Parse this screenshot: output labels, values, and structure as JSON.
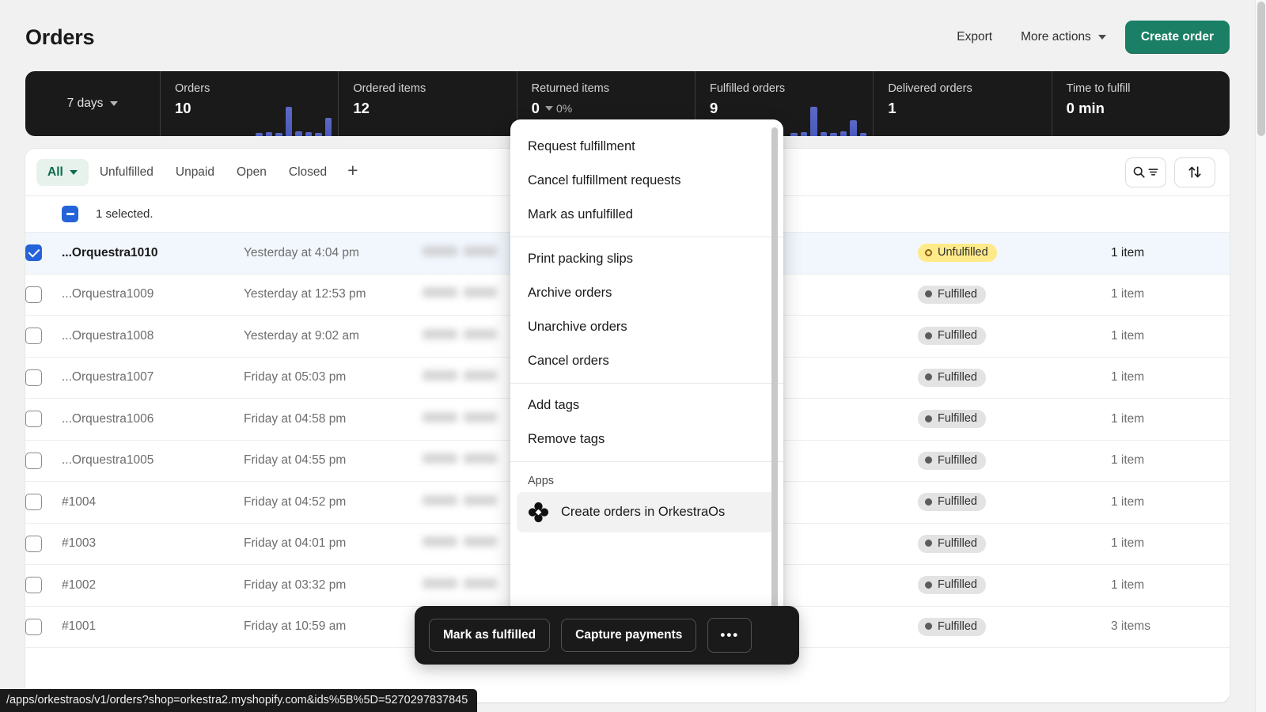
{
  "header": {
    "title": "Orders",
    "export_label": "Export",
    "more_actions_label": "More actions",
    "create_order_label": "Create order"
  },
  "stats": {
    "range_label": "7 days",
    "cells": [
      {
        "label": "Orders",
        "value": "10",
        "delta": "",
        "sparkline": [
          8,
          10,
          9,
          62,
          12,
          11,
          9,
          40
        ]
      },
      {
        "label": "Ordered items",
        "value": "12",
        "delta": "",
        "sparkline": []
      },
      {
        "label": "Returned items",
        "value": "0",
        "delta": "0%",
        "sparkline": []
      },
      {
        "label": "Fulfilled orders",
        "value": "9",
        "delta": "",
        "sparkline": [
          8,
          9,
          62,
          10,
          9,
          12,
          34,
          9
        ]
      },
      {
        "label": "Delivered orders",
        "value": "1",
        "delta": "",
        "sparkline": []
      },
      {
        "label": "Time to fulfill",
        "value": "0 min",
        "delta": "",
        "sparkline": []
      }
    ]
  },
  "tabs": {
    "items": [
      {
        "label": "All",
        "active": true,
        "has_caret": true
      },
      {
        "label": "Unfulfilled",
        "active": false,
        "has_caret": false
      },
      {
        "label": "Unpaid",
        "active": false,
        "has_caret": false
      },
      {
        "label": "Open",
        "active": false,
        "has_caret": false
      },
      {
        "label": "Closed",
        "active": false,
        "has_caret": false
      }
    ],
    "add_label": "+"
  },
  "bulk": {
    "selected_text": "1 selected."
  },
  "table": {
    "rows": [
      {
        "order": "...Orquestra1010",
        "date": "Yesterday at 4:04 pm",
        "status": "Unfulfilled",
        "status_type": "unfulfilled",
        "items": "1 item",
        "selected": true
      },
      {
        "order": "...Orquestra1009",
        "date": "Yesterday at 12:53 pm",
        "status": "Fulfilled",
        "status_type": "fulfilled",
        "items": "1 item",
        "selected": false
      },
      {
        "order": "...Orquestra1008",
        "date": "Yesterday at 9:02 am",
        "status": "Fulfilled",
        "status_type": "fulfilled",
        "items": "1 item",
        "selected": false
      },
      {
        "order": "...Orquestra1007",
        "date": "Friday at 05:03 pm",
        "status": "Fulfilled",
        "status_type": "fulfilled",
        "items": "1 item",
        "selected": false
      },
      {
        "order": "...Orquestra1006",
        "date": "Friday at 04:58 pm",
        "status": "Fulfilled",
        "status_type": "fulfilled",
        "items": "1 item",
        "selected": false
      },
      {
        "order": "...Orquestra1005",
        "date": "Friday at 04:55 pm",
        "status": "Fulfilled",
        "status_type": "fulfilled",
        "items": "1 item",
        "selected": false
      },
      {
        "order": "#1004",
        "date": "Friday at 04:52 pm",
        "status": "Fulfilled",
        "status_type": "fulfilled",
        "items": "1 item",
        "selected": false
      },
      {
        "order": "#1003",
        "date": "Friday at 04:01 pm",
        "status": "Fulfilled",
        "status_type": "fulfilled",
        "items": "1 item",
        "selected": false
      },
      {
        "order": "#1002",
        "date": "Friday at 03:32 pm",
        "status": "Fulfilled",
        "status_type": "fulfilled",
        "items": "1 item",
        "selected": false
      },
      {
        "order": "#1001",
        "date": "Friday at 10:59 am",
        "status": "Fulfilled",
        "status_type": "fulfilled",
        "items": "3 items",
        "selected": false
      }
    ]
  },
  "menu": {
    "groups": [
      {
        "items": [
          {
            "label": "Request fulfillment"
          },
          {
            "label": "Cancel fulfillment requests"
          },
          {
            "label": "Mark as unfulfilled"
          }
        ]
      },
      {
        "items": [
          {
            "label": "Print packing slips"
          },
          {
            "label": "Archive orders"
          },
          {
            "label": "Unarchive orders"
          },
          {
            "label": "Cancel orders"
          }
        ]
      },
      {
        "items": [
          {
            "label": "Add tags"
          },
          {
            "label": "Remove tags"
          }
        ]
      }
    ],
    "apps_label": "Apps",
    "app_item": "Create orders in OrkestraOs"
  },
  "bulk_toolbar": {
    "mark_fulfilled_label": "Mark as fulfilled",
    "capture_payments_label": "Capture payments",
    "more_label": "•••"
  },
  "status_bar": {
    "url": "/apps/orkestraos/v1/orders?shop=orkestra2.myshopify.com&ids%5B%5D=5270297837845"
  },
  "colors": {
    "accent_green": "#1a7f64",
    "tab_active_bg": "#e7f2ed",
    "selected_row_bg": "#f2f7fe",
    "checkbox_blue": "#2563d9",
    "badge_unfulfilled": "#ffea8a",
    "badge_fulfilled": "#e3e3e3",
    "dark_surface": "#1a1a1a",
    "sparkline_bar": "#5c6ac4"
  }
}
